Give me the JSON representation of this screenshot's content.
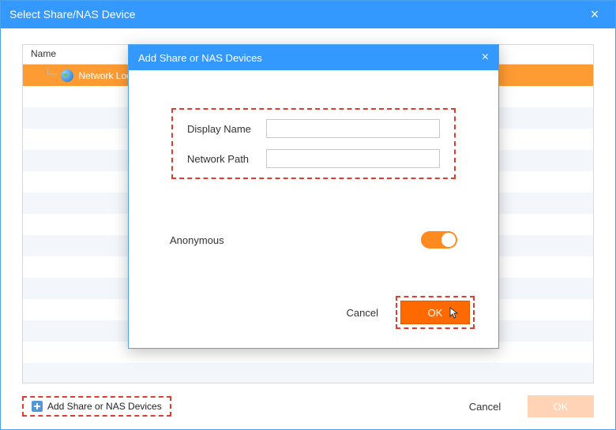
{
  "outer": {
    "title": "Select Share/NAS Device",
    "columns": {
      "name": "Name",
      "extra": ""
    },
    "tree": {
      "item0": "Network Location"
    },
    "footer": {
      "add_label": "Add Share or NAS Devices",
      "cancel": "Cancel",
      "ok": "OK"
    }
  },
  "inner": {
    "title": "Add Share or NAS Devices",
    "form": {
      "display_name_label": "Display Name",
      "display_name_value": "",
      "network_path_label": "Network Path",
      "network_path_value": ""
    },
    "anonymous_label": "Anonymous",
    "anonymous_on": true,
    "footer": {
      "cancel": "Cancel",
      "ok": "OK"
    }
  },
  "colors": {
    "primary_blue": "#3399ff",
    "accent_orange": "#ff6a00",
    "highlight_dash": "#e23a2e"
  }
}
